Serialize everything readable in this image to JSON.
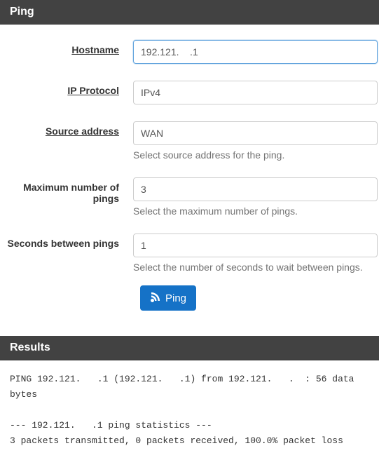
{
  "panel": {
    "title": "Ping",
    "results_title": "Results"
  },
  "form": {
    "hostname": {
      "label": "Hostname",
      "value": "192.121.    .1"
    },
    "ip_protocol": {
      "label": "IP Protocol",
      "value": "IPv4"
    },
    "source_address": {
      "label": "Source address",
      "value": "WAN",
      "help": "Select source address for the ping."
    },
    "max_pings": {
      "label": "Maximum number of pings",
      "value": "3",
      "help": "Select the maximum number of pings."
    },
    "seconds_between": {
      "label": "Seconds between pings",
      "value": "1",
      "help": "Select the number of seconds to wait between pings."
    },
    "submit_label": "Ping"
  },
  "results": {
    "output": "PING 192.121.   .1 (192.121.   .1) from 192.121.   .  : 56 data bytes\n\n--- 192.121.   .1 ping statistics ---\n3 packets transmitted, 0 packets received, 100.0% packet loss"
  }
}
